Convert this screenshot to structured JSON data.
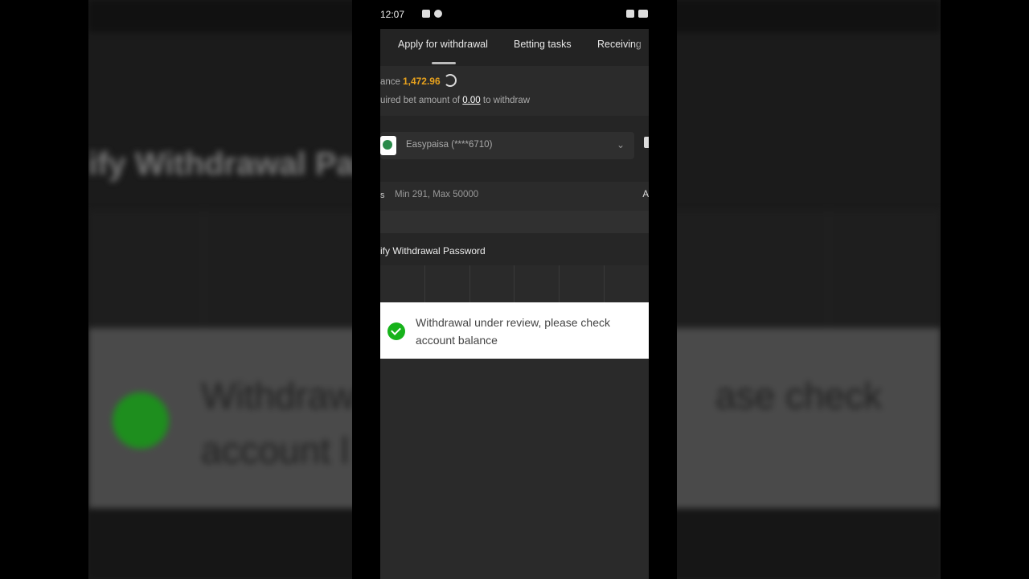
{
  "status_bar": {
    "time": "12:07"
  },
  "tabs": [
    {
      "label": "Apply for withdrawal",
      "active": true
    },
    {
      "label": "Betting tasks",
      "active": false
    },
    {
      "label": "Receiving",
      "active": false
    }
  ],
  "balance": {
    "label": "ance",
    "value": "1,472.96"
  },
  "bet_requirement": {
    "prefix": "uired bet amount of",
    "amount": "0.00",
    "suffix": "to withdraw"
  },
  "payment_method": {
    "label": "Easypaisa (****6710)"
  },
  "amount_field": {
    "left_glyph": "s",
    "hint": "Min 291, Max 50000",
    "right_glyph": "A"
  },
  "password_section": {
    "title": "ify Withdrawal Password"
  },
  "toast": {
    "message": "Withdrawal under review, please check account balance"
  },
  "background_blur": {
    "title": "ify Withdrawal Passv",
    "message_left": "Withdraw\naccount l",
    "message_right": "ase check"
  },
  "colors": {
    "accent": "#e8a21d",
    "success": "#17b31b"
  }
}
